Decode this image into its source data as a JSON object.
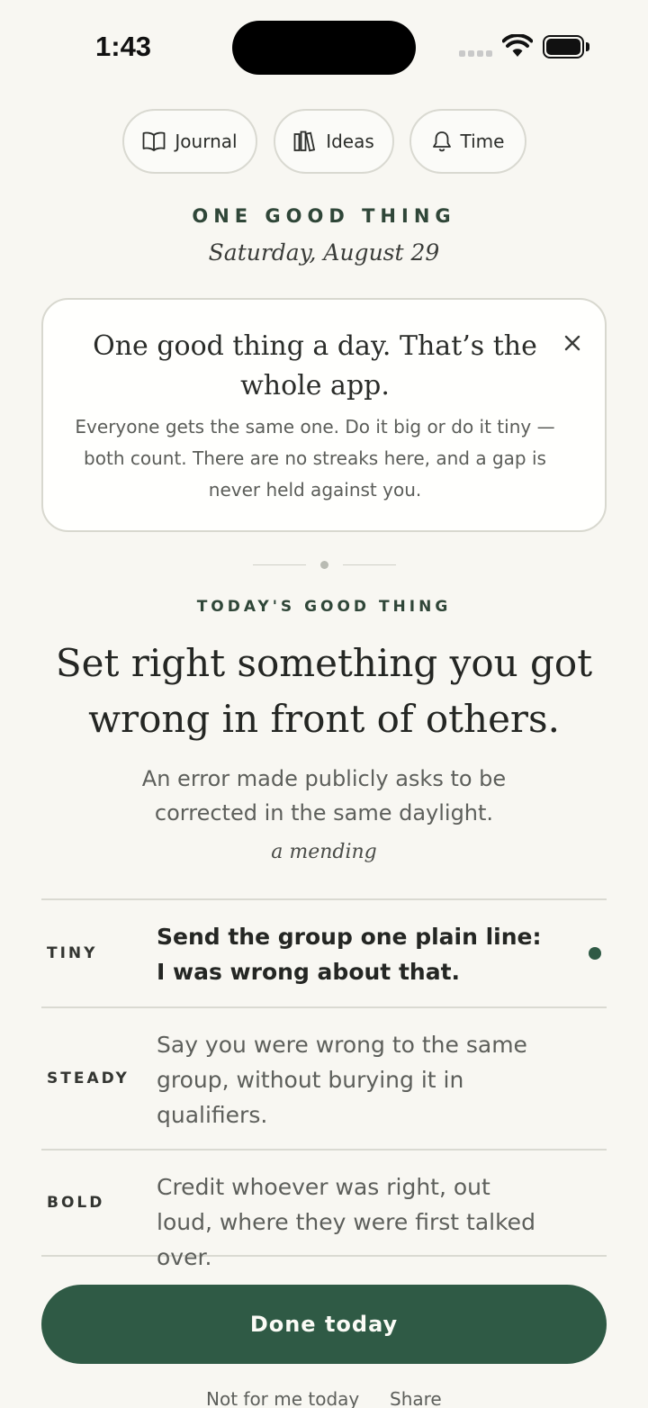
{
  "status_bar": {
    "time": "1:43"
  },
  "nav": {
    "journal_label": "Journal",
    "ideas_label": "Ideas",
    "time_label": "Time"
  },
  "header": {
    "app_title": "ONE GOOD THING",
    "date": "Saturday, August 29"
  },
  "intro_card": {
    "title": "One good thing a day. That’s the whole app.",
    "body": "Everyone gets the same one. Do it big or do it tiny — both count. There are no streaks here, and a gap is never held against you."
  },
  "today": {
    "section_label": "TODAY'S GOOD THING",
    "headline": "Set right something you got wrong in front of others.",
    "subhead": "An error made publicly asks to be corrected in the same daylight.",
    "tag": "a mending"
  },
  "options": [
    {
      "level": "TINY",
      "text": "Send the group one plain line: I was wrong about that.",
      "selected": true
    },
    {
      "level": "STEADY",
      "text": "Say you were wrong to the same group, without burying it in qualifiers.",
      "selected": false
    },
    {
      "level": "BOLD",
      "text": "Credit whoever was right, out loud, where they were first talked over.",
      "selected": false
    }
  ],
  "actions": {
    "done_label": "Done today",
    "skip_label": "Not for me today",
    "share_label": "Share"
  },
  "colors": {
    "background": "#f8f7f2",
    "accent": "#2f5a45",
    "heading_green": "#2f4638"
  }
}
